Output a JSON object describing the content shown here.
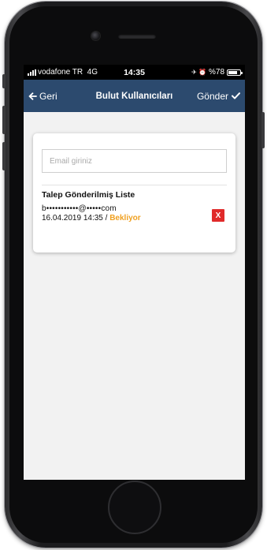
{
  "statusbar": {
    "carrier": "vodafone TR",
    "network": "4G",
    "time": "14:35",
    "icons_text": "✈ ⏰",
    "battery": "%78",
    "battery_level": 0.78
  },
  "navbar": {
    "back_label": "Geri",
    "title": "Bulut Kullanıcıları",
    "send_label": "Gönder"
  },
  "form": {
    "email_placeholder": "Email giriniz",
    "email_value": ""
  },
  "requests": {
    "title": "Talep Gönderilmiş Liste",
    "items": [
      {
        "email": "b•••••••••••@•••••com",
        "date": "16.04.2019 14:35",
        "separator": " / ",
        "status": "Bekliyor",
        "remove_label": "X"
      }
    ]
  },
  "colors": {
    "navbar": "#2c4a6e",
    "status_pending": "#f0a020",
    "remove": "#e02a2a",
    "screen_background": "#f2f2f2"
  }
}
